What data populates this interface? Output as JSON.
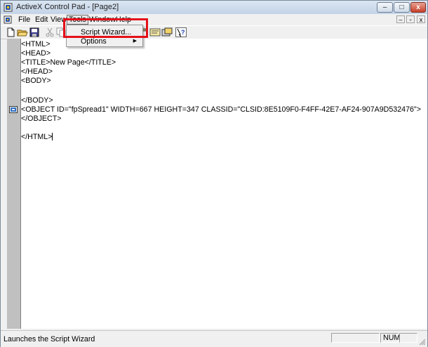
{
  "window": {
    "title": "ActiveX Control Pad - [Page2]",
    "caption_buttons": {
      "minimize": "–",
      "maximize": "□",
      "close": "x"
    }
  },
  "menubar": {
    "items": [
      {
        "label": "File"
      },
      {
        "label": "Edit"
      },
      {
        "label": "View"
      },
      {
        "label": "Tools"
      },
      {
        "label": "Window"
      },
      {
        "label": "Help"
      }
    ],
    "mdi_buttons": {
      "minimize": "–",
      "restore": "▫",
      "close": "x"
    }
  },
  "tools_menu": {
    "items": [
      {
        "label": "Script Wizard...",
        "has_submenu": false
      },
      {
        "label": "Options",
        "has_submenu": true,
        "arrow": "▶"
      }
    ]
  },
  "toolbar": {
    "buttons": [
      {
        "icon": "new-page-icon"
      },
      {
        "icon": "open-folder-icon"
      },
      {
        "icon": "save-icon"
      },
      {
        "icon": "cut-icon"
      },
      {
        "icon": "copy-icon"
      },
      {
        "icon": "paste-icon"
      },
      {
        "icon": "script-wizard-icon"
      },
      {
        "icon": "insert-object-icon"
      },
      {
        "icon": "help-context-icon"
      }
    ]
  },
  "editor": {
    "lines": [
      "<HTML>",
      "<HEAD>",
      "<TITLE>New Page</TITLE>",
      "</HEAD>",
      "<BODY>",
      "",
      "</BODY>",
      "<OBJECT ID=\"fpSpread1\" WIDTH=667 HEIGHT=347 CLASSID=\"CLSID:8E5109F0-F4FF-42E7-AF24-907A9D532476\">",
      "</OBJECT>",
      "",
      "",
      "</HTML>"
    ],
    "object_marker_icon": "activex-object-icon"
  },
  "statusbar": {
    "message": "Launches the Script Wizard",
    "num_indicator": "NUM"
  },
  "colors": {
    "highlight_box": "#e5101a",
    "gutter": "#c0c0c0",
    "chrome": "#f0f0f0"
  }
}
